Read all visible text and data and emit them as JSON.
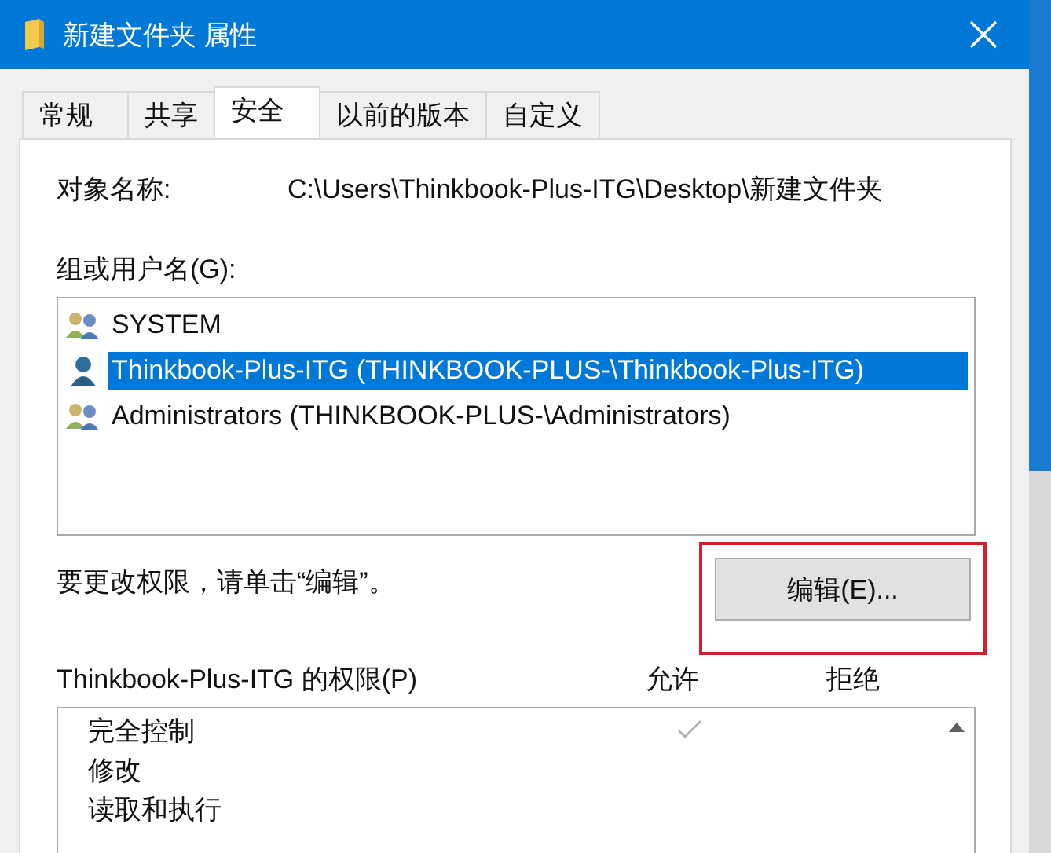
{
  "window": {
    "title": "新建文件夹 属性"
  },
  "tabs": [
    {
      "label": "常规",
      "selected": false
    },
    {
      "label": "共享",
      "selected": false
    },
    {
      "label": "安全",
      "selected": true
    },
    {
      "label": "以前的版本",
      "selected": false
    },
    {
      "label": "自定义",
      "selected": false
    }
  ],
  "object_name": {
    "label": "对象名称:",
    "value": "C:\\Users\\Thinkbook-Plus-ITG\\Desktop\\新建文件夹"
  },
  "groups": {
    "label": "组或用户名(G):",
    "items": [
      {
        "name": "SYSTEM",
        "kind": "group",
        "selected": false
      },
      {
        "name": "Thinkbook-Plus-ITG (THINKBOOK-PLUS-\\Thinkbook-Plus-ITG)",
        "kind": "user",
        "selected": true
      },
      {
        "name": "Administrators (THINKBOOK-PLUS-\\Administrators)",
        "kind": "group",
        "selected": false
      }
    ]
  },
  "edit_hint": "要更改权限，请单击“编辑”。",
  "edit_button": {
    "label": "编辑(E)...",
    "highlighted": true
  },
  "permissions": {
    "label": "Thinkbook-Plus-ITG 的权限(P)",
    "allow_header": "允许",
    "deny_header": "拒绝",
    "rows": [
      {
        "name": "完全控制",
        "allow": true
      },
      {
        "name": "修改",
        "allow": false
      },
      {
        "name": "读取和执行",
        "allow": false
      }
    ]
  }
}
